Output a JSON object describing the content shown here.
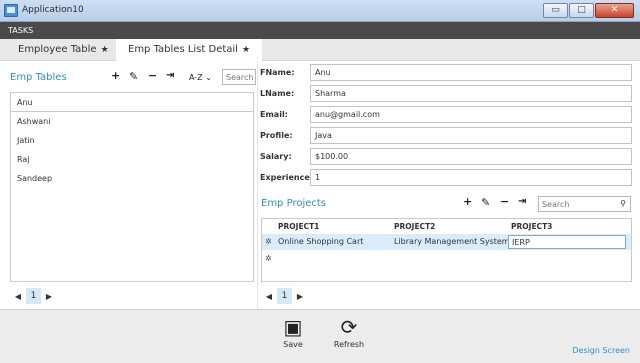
{
  "window": {
    "title": "Application10",
    "minimize": "▭",
    "maximize": "□",
    "close": "✕"
  },
  "tasks_label": "TASKS",
  "tabs": [
    {
      "label": "Employee Table",
      "star": "★"
    },
    {
      "label": "Emp Tables List Detail",
      "star": "★"
    }
  ],
  "left": {
    "title": "Emp Tables",
    "sort_label": "A-Z",
    "search_placeholder": "Search",
    "items": [
      "Anu",
      "Ashwani",
      "Jatin",
      "Raj",
      "Sandeep"
    ],
    "page": "1"
  },
  "detail": {
    "fields": [
      {
        "label": "FName:",
        "value": "Anu"
      },
      {
        "label": "LName:",
        "value": "Sharma"
      },
      {
        "label": "Email:",
        "value": "anu@gmail.com"
      },
      {
        "label": "Profile:",
        "value": "Java"
      },
      {
        "label": "Salary:",
        "value": "$100.00"
      },
      {
        "label": "Experience:",
        "value": "1"
      }
    ]
  },
  "projects": {
    "title": "Emp Projects",
    "search_placeholder": "Search",
    "columns": [
      "PROJECT1",
      "PROJECT2",
      "PROJECT3"
    ],
    "rows": [
      [
        "Online Shopping Cart",
        "Library Management System",
        "IERP"
      ]
    ],
    "page": "1"
  },
  "commands": {
    "save": "Save",
    "refresh": "Refresh"
  },
  "design_screen": "Design Screen",
  "colors": {
    "accent": "#2f8fc7",
    "selected_row": "#d9ecfb",
    "tasks_bar": "#4a4a4a"
  },
  "icons": {
    "add": "add-icon",
    "edit": "pencil-icon",
    "remove": "minus-icon",
    "export": "export-icon",
    "search": "search-icon",
    "save": "save-icon",
    "refresh": "refresh-icon"
  }
}
